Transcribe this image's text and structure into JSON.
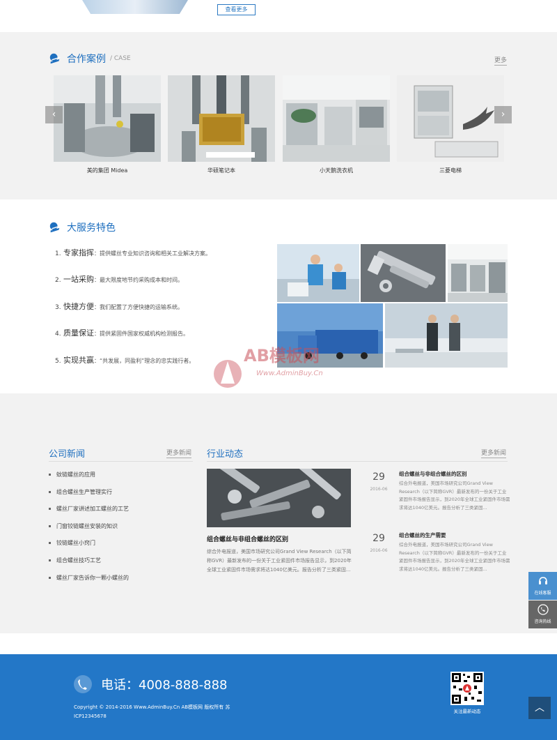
{
  "top": {
    "more_button": "查看更多"
  },
  "cases": {
    "title": "合作案例",
    "subtitle": "/ CASE",
    "more": "更多",
    "prev_arrow": "‹",
    "next_arrow": "›",
    "items": [
      {
        "caption": "美的集团 Midea"
      },
      {
        "caption": "华硕笔记本"
      },
      {
        "caption": "小天鹅洗衣机"
      },
      {
        "caption": "三菱电梯"
      }
    ]
  },
  "service": {
    "title": "大服务特色",
    "items": [
      {
        "num": "1.",
        "key": "专家指挥",
        "text": "：提供螺丝专业知识咨询和相关工业解决方案。"
      },
      {
        "num": "2.",
        "key": "一站采购",
        "text": "：最大限度地节约采购成本和时间。"
      },
      {
        "num": "3.",
        "key": "快捷方便",
        "text": "：我们配置了方便快捷的运输系统。"
      },
      {
        "num": "4.",
        "key": "质量保证",
        "text": "：提供紧固件国家权威机构检测报告。"
      },
      {
        "num": "5.",
        "key": "实现共赢",
        "text": "：“共发展，同盈利”理念的忠实践行者。"
      }
    ]
  },
  "watermark": {
    "brand": "AB模板网",
    "url": "Www.AdminBuy.Cn"
  },
  "company_news": {
    "title": "公司新闻",
    "more": "更多新闻",
    "items": [
      "蚊链螺丝的应用",
      "组合螺丝生产管理实行",
      "螺丝厂家讲述加工螺丝的工艺",
      "门窗铰链螺丝安装的知识",
      "铰链螺丝小窍门",
      "组合螺丝技巧工艺",
      "螺丝厂家告诉你一颗小螺丝的"
    ]
  },
  "industry": {
    "title": "行业动态",
    "more": "更多新闻",
    "headline": "组合螺丝与非组合螺丝的区别",
    "summary": "综合外电报道，美国市场研究公司Grand View Research（以下简称GVR）最新发布的一份关于工业紧固件市场报告显示，到2020年全球工业紧固件市场需求将达1040亿美元。报告分析了三类紧固...",
    "items": [
      {
        "day": "29",
        "ym": "2016-06",
        "title": "组合螺丝与非组合螺丝的区别",
        "text": "综合外电报道，美国市场研究公司Grand View Research（以下简称GVR）最新发布的一份关于工业紧固件市场报告显示，到2020年全球工业紧固件市场需求将达1040亿美元。报告分析了三类紧固..."
      },
      {
        "day": "29",
        "ym": "2016-06",
        "title": "组合螺丝的生产需要",
        "text": "综合外电报道，美国市场研究公司Grand View Research（以下简称GVR）最新发布的一份关于工业紧固件市场报告显示，到2020年全球工业紧固件市场需求将达1040亿美元。报告分析了三类紧固..."
      }
    ]
  },
  "footer": {
    "phone": "电话：4008-888-888",
    "copyright": "Copyright © 2014-2016 Www.AdminBuy.Cn AB模板网 版权所有   苏ICP12345678",
    "qr_caption": "关注最新动态"
  },
  "side": {
    "online": "在线客服",
    "hotline": "咨询热线",
    "totop": "︿"
  },
  "colors": {
    "accent": "#1e6fbf",
    "footer_bg": "#2377c7",
    "side_blue": "#4a90cf",
    "side_gray": "#666666"
  }
}
